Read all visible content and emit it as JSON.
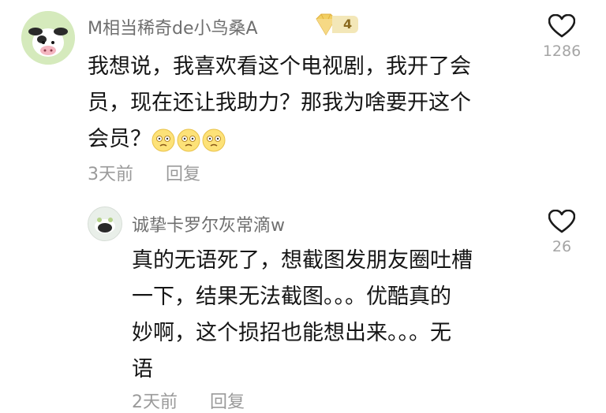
{
  "comment": {
    "username": "M相当稀奇de小鸟桑A",
    "badge_level": "4",
    "lines": [
      "我想说，我喜欢看这个电视剧，我开了会",
      "员，现在还让我助力？那我为啥要开这个",
      "会员？"
    ],
    "emoji_names": [
      "frown-emoji",
      "frown-emoji",
      "frown-emoji"
    ],
    "time": "3天前",
    "reply_label": "回复",
    "like_count": "1286",
    "reply": {
      "username": "诚挚卡罗尔灰常滴w",
      "lines": [
        "真的无语死了，想截图发朋友圈吐槽",
        "一下，结果无法截图。。。优酷真的",
        "妙啊，这个损招也能想出来。。。无",
        "语"
      ],
      "time": "2天前",
      "reply_label": "回复",
      "like_count": "26"
    }
  },
  "colors": {
    "username": "#6f6f6f",
    "body_text": "#161616",
    "meta_text": "#9a9a9a",
    "badge_gold": "#f2cf62"
  },
  "icons": [
    "cow-avatar",
    "diamond-badge-icon",
    "heart-outline-icon",
    "round-avatar"
  ]
}
